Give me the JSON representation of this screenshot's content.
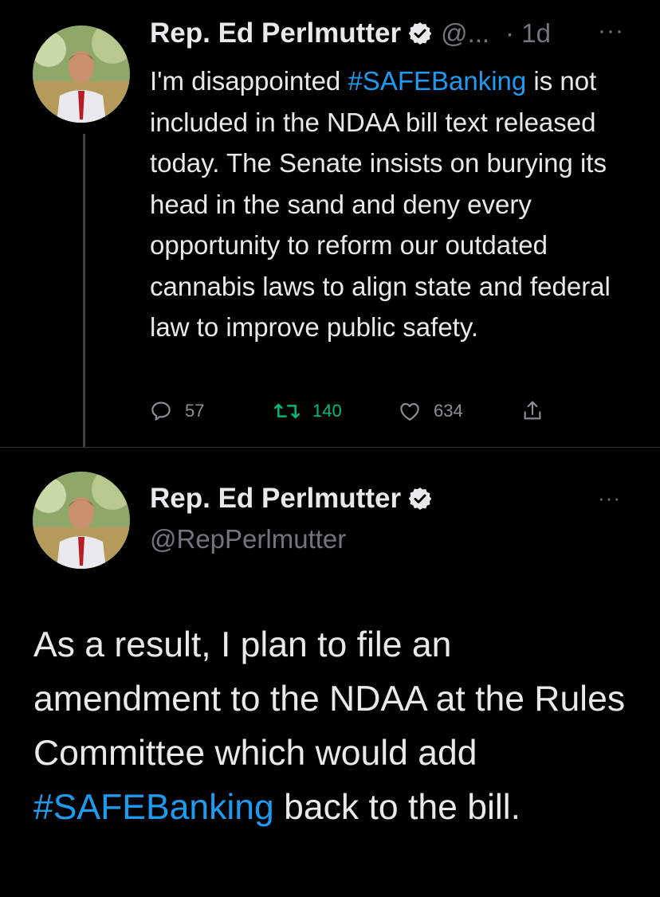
{
  "tweet1": {
    "name": "Rep. Ed Perlmutter",
    "handle_truncated": "@...",
    "time": "· 1d",
    "more": "···",
    "text_parts": {
      "pre": "I'm disappointed ",
      "hashtag": "#SAFEBanking",
      "post": " is not included in the NDAA bill text released today. The Senate insists on burying its head in the sand and deny every opportunity to reform our outdated cannabis laws to align state and federal law to improve public safety."
    },
    "replies": "57",
    "retweets": "140",
    "likes": "634"
  },
  "tweet2": {
    "name": "Rep. Ed Perlmutter",
    "handle": "@RepPerlmutter",
    "more": "···",
    "text_parts": {
      "pre": "As a result, I plan to file an amendment to the NDAA at the Rules Committee which would add ",
      "hashtag": "#SAFEBanking",
      "post": " back to the bill."
    }
  },
  "colors": {
    "background": "#000000",
    "text": "#e7e9ea",
    "secondary": "#71767b",
    "hashtag": "#1d9bf0",
    "retweet_active": "#00ba7c",
    "divider": "#2f3336"
  },
  "icons": [
    "verified-badge-icon",
    "reply-icon",
    "retweet-icon",
    "like-icon",
    "share-icon",
    "more-icon"
  ]
}
